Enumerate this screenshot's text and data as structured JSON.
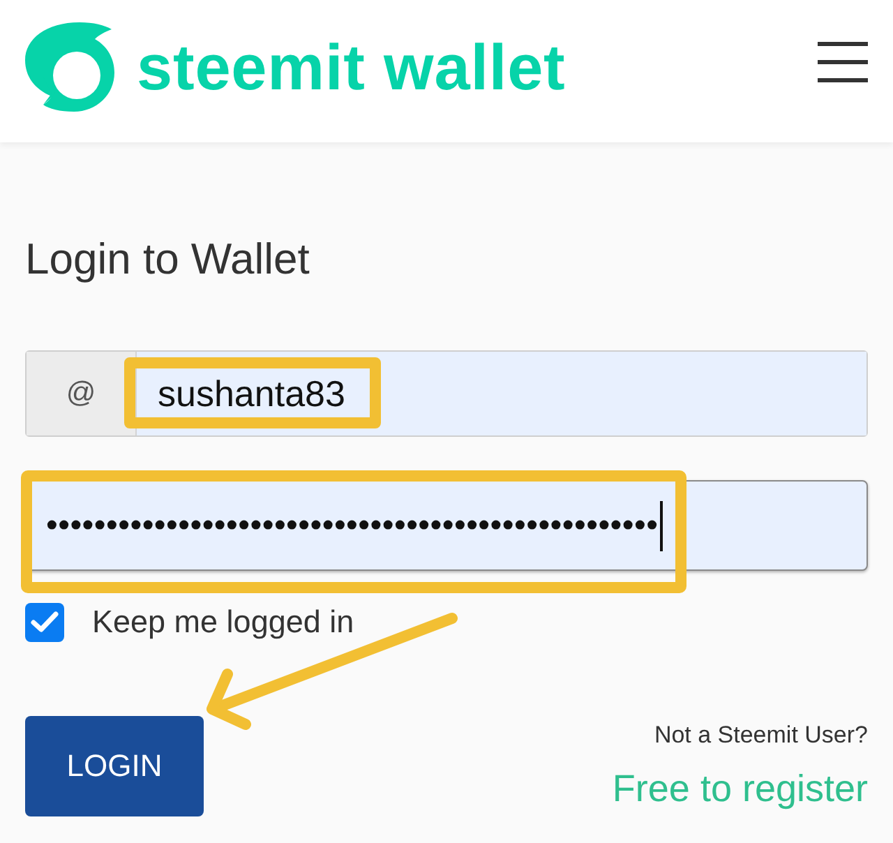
{
  "header": {
    "logo_text": "steemit wallet"
  },
  "login_form": {
    "title": "Login to Wallet",
    "username": {
      "prefix": "@",
      "value": "sushanta83",
      "focused": false
    },
    "password": {
      "masked_value": "•••••••••••••••••••••••••••••••••••••••••••••••••••",
      "focused": true
    },
    "keep_logged_in": {
      "label": "Keep me logged in",
      "checked": true
    },
    "login_button": "LOGIN",
    "signup_prompt": "Not a Steemit User?",
    "register_link": "Free to register"
  }
}
